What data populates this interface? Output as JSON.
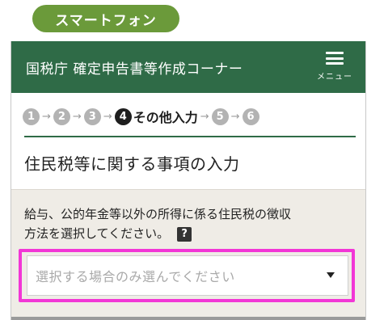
{
  "badge": {
    "label": "スマートフォン"
  },
  "header": {
    "title": "国税庁 確定申告書等作成コーナー",
    "menu_label": "メニュー"
  },
  "steps": {
    "items": [
      "1",
      "2",
      "3",
      "4",
      "5",
      "6"
    ],
    "arrow": "→",
    "current_index": 4,
    "current_label": "その他入力"
  },
  "section": {
    "title": "住民税等に関する事項の入力"
  },
  "question": {
    "text_line1": "給与、公的年金等以外の所得に係る住民税の徴収",
    "text_line2": "方法を選択してください。",
    "help_icon": "?"
  },
  "select": {
    "placeholder": "選択する場合のみ選んでください"
  },
  "colors": {
    "header_bg": "#2f6b47",
    "badge_bg": "#6b9a3a",
    "highlight": "#f236d6"
  }
}
